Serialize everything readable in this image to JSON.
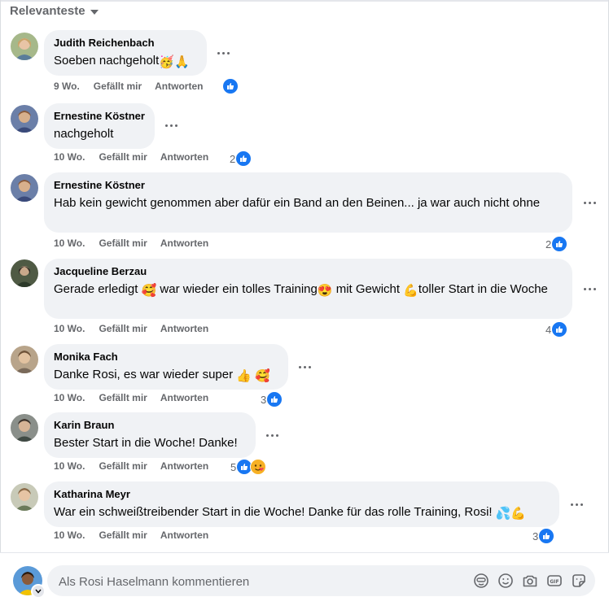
{
  "sort": {
    "label": "Relevanteste"
  },
  "actions": {
    "like": "Gefällt mir",
    "reply": "Antworten"
  },
  "comments": [
    {
      "author": "Judith Reichenbach",
      "text": "Soeben nachgeholt",
      "emoji": "🥳🙏",
      "time": "9 Wo.",
      "count": ""
    },
    {
      "author": "Ernestine Köstner",
      "text": "nachgeholt",
      "emoji": "",
      "time": "10 Wo.",
      "count": "2"
    },
    {
      "author": "Ernestine Köstner",
      "text": "Hab kein gewicht genommen aber dafür ein Band an den Beinen... ja war auch nicht ohne",
      "emoji": "",
      "time": "10 Wo.",
      "count": "2"
    },
    {
      "author": "Jacqueline Berzau",
      "text_1": "Gerade erledigt",
      "emoji_1": "🥰",
      "text_2": " war wieder ein tolles Training",
      "emoji_2": "😍",
      "text_3": " mit Gewicht ",
      "emoji_3": "💪",
      "text_4": "toller Start in die Woche",
      "time": "10 Wo.",
      "count": "4"
    },
    {
      "author": "Monika Fach",
      "text": "Danke Rosi, es war wieder super ",
      "emoji": "👍 🥰",
      "time": "10 Wo.",
      "count": "3"
    },
    {
      "author": "Karin Braun",
      "text": "Bester Start in die Woche! Danke!",
      "emoji": "",
      "time": "10 Wo.",
      "count": "5"
    },
    {
      "author": "Katharina Meyr",
      "text": "War ein schweißtreibender Start in die Woche! Danke für das rolle Training, Rosi! ",
      "emoji": "💦💪",
      "time": "10 Wo.",
      "count": "3"
    }
  ],
  "composer": {
    "placeholder": "Als Rosi Haselmann kommentieren"
  },
  "icons": [
    "chevron-down-icon",
    "more-icon",
    "like-icon",
    "love-icon",
    "avatar-icon",
    "sticker-avatar-icon",
    "emoji-icon",
    "camera-icon",
    "gif-icon",
    "sticker-icon"
  ],
  "colors": {
    "like": "#1877f2",
    "bubble": "#f0f2f5",
    "muted": "#65676b"
  }
}
